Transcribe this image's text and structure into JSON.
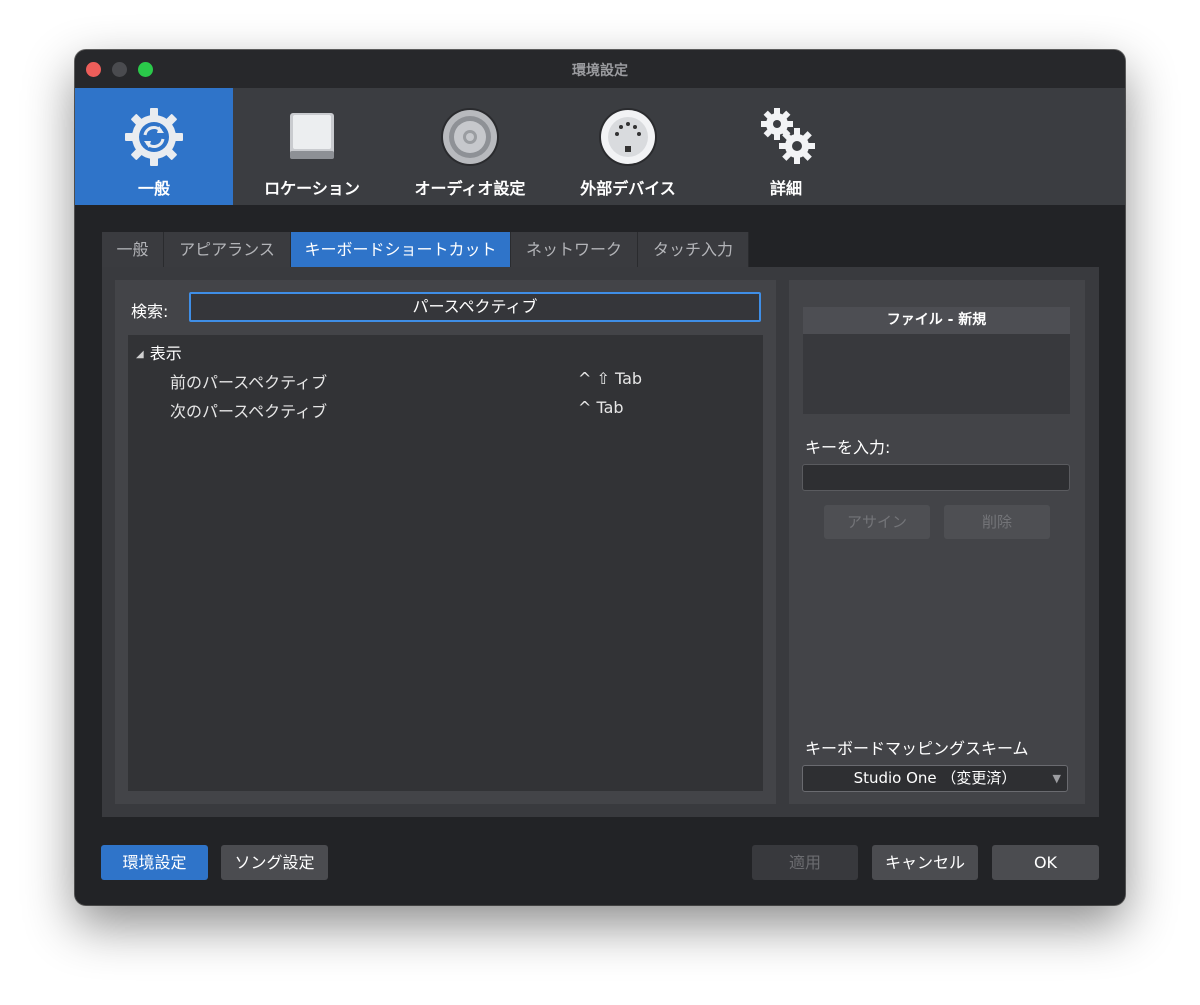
{
  "window": {
    "title": "環境設定"
  },
  "toolbar": {
    "items": [
      {
        "label": "一般",
        "icon": "gear-sync-icon",
        "active": true
      },
      {
        "label": "ロケーション",
        "icon": "drive-icon"
      },
      {
        "label": "オーディオ設定",
        "icon": "speaker-icon"
      },
      {
        "label": "外部デバイス",
        "icon": "midi-connector-icon"
      },
      {
        "label": "詳細",
        "icon": "gears-icon"
      }
    ]
  },
  "tabs": [
    {
      "label": "一般"
    },
    {
      "label": "アピアランス"
    },
    {
      "label": "キーボードショートカット",
      "active": true
    },
    {
      "label": "ネットワーク"
    },
    {
      "label": "タッチ入力"
    }
  ],
  "search": {
    "label": "検索:",
    "value": "パースペクティブ"
  },
  "tree": {
    "group": "表示",
    "rows": [
      {
        "command": "前のパースペクティブ",
        "shortcut": "^ ⇧ Tab"
      },
      {
        "command": "次のパースペクティブ",
        "shortcut": "^ Tab"
      }
    ]
  },
  "right_panel": {
    "command_title": "ファイル - 新規",
    "key_input_label": "キーを入力:",
    "assign_label": "アサイン",
    "delete_label": "削除",
    "scheme_label": "キーボードマッピングスキーム",
    "scheme_value": "Studio One （変更済）"
  },
  "footer": {
    "prefs_label": "環境設定",
    "song_label": "ソング設定",
    "apply_label": "適用",
    "cancel_label": "キャンセル",
    "ok_label": "OK"
  },
  "colors": {
    "accent": "#2f74c9",
    "close": "#ed5e5a",
    "maximize": "#2ac94a",
    "search_focus": "#3f8ee6"
  }
}
